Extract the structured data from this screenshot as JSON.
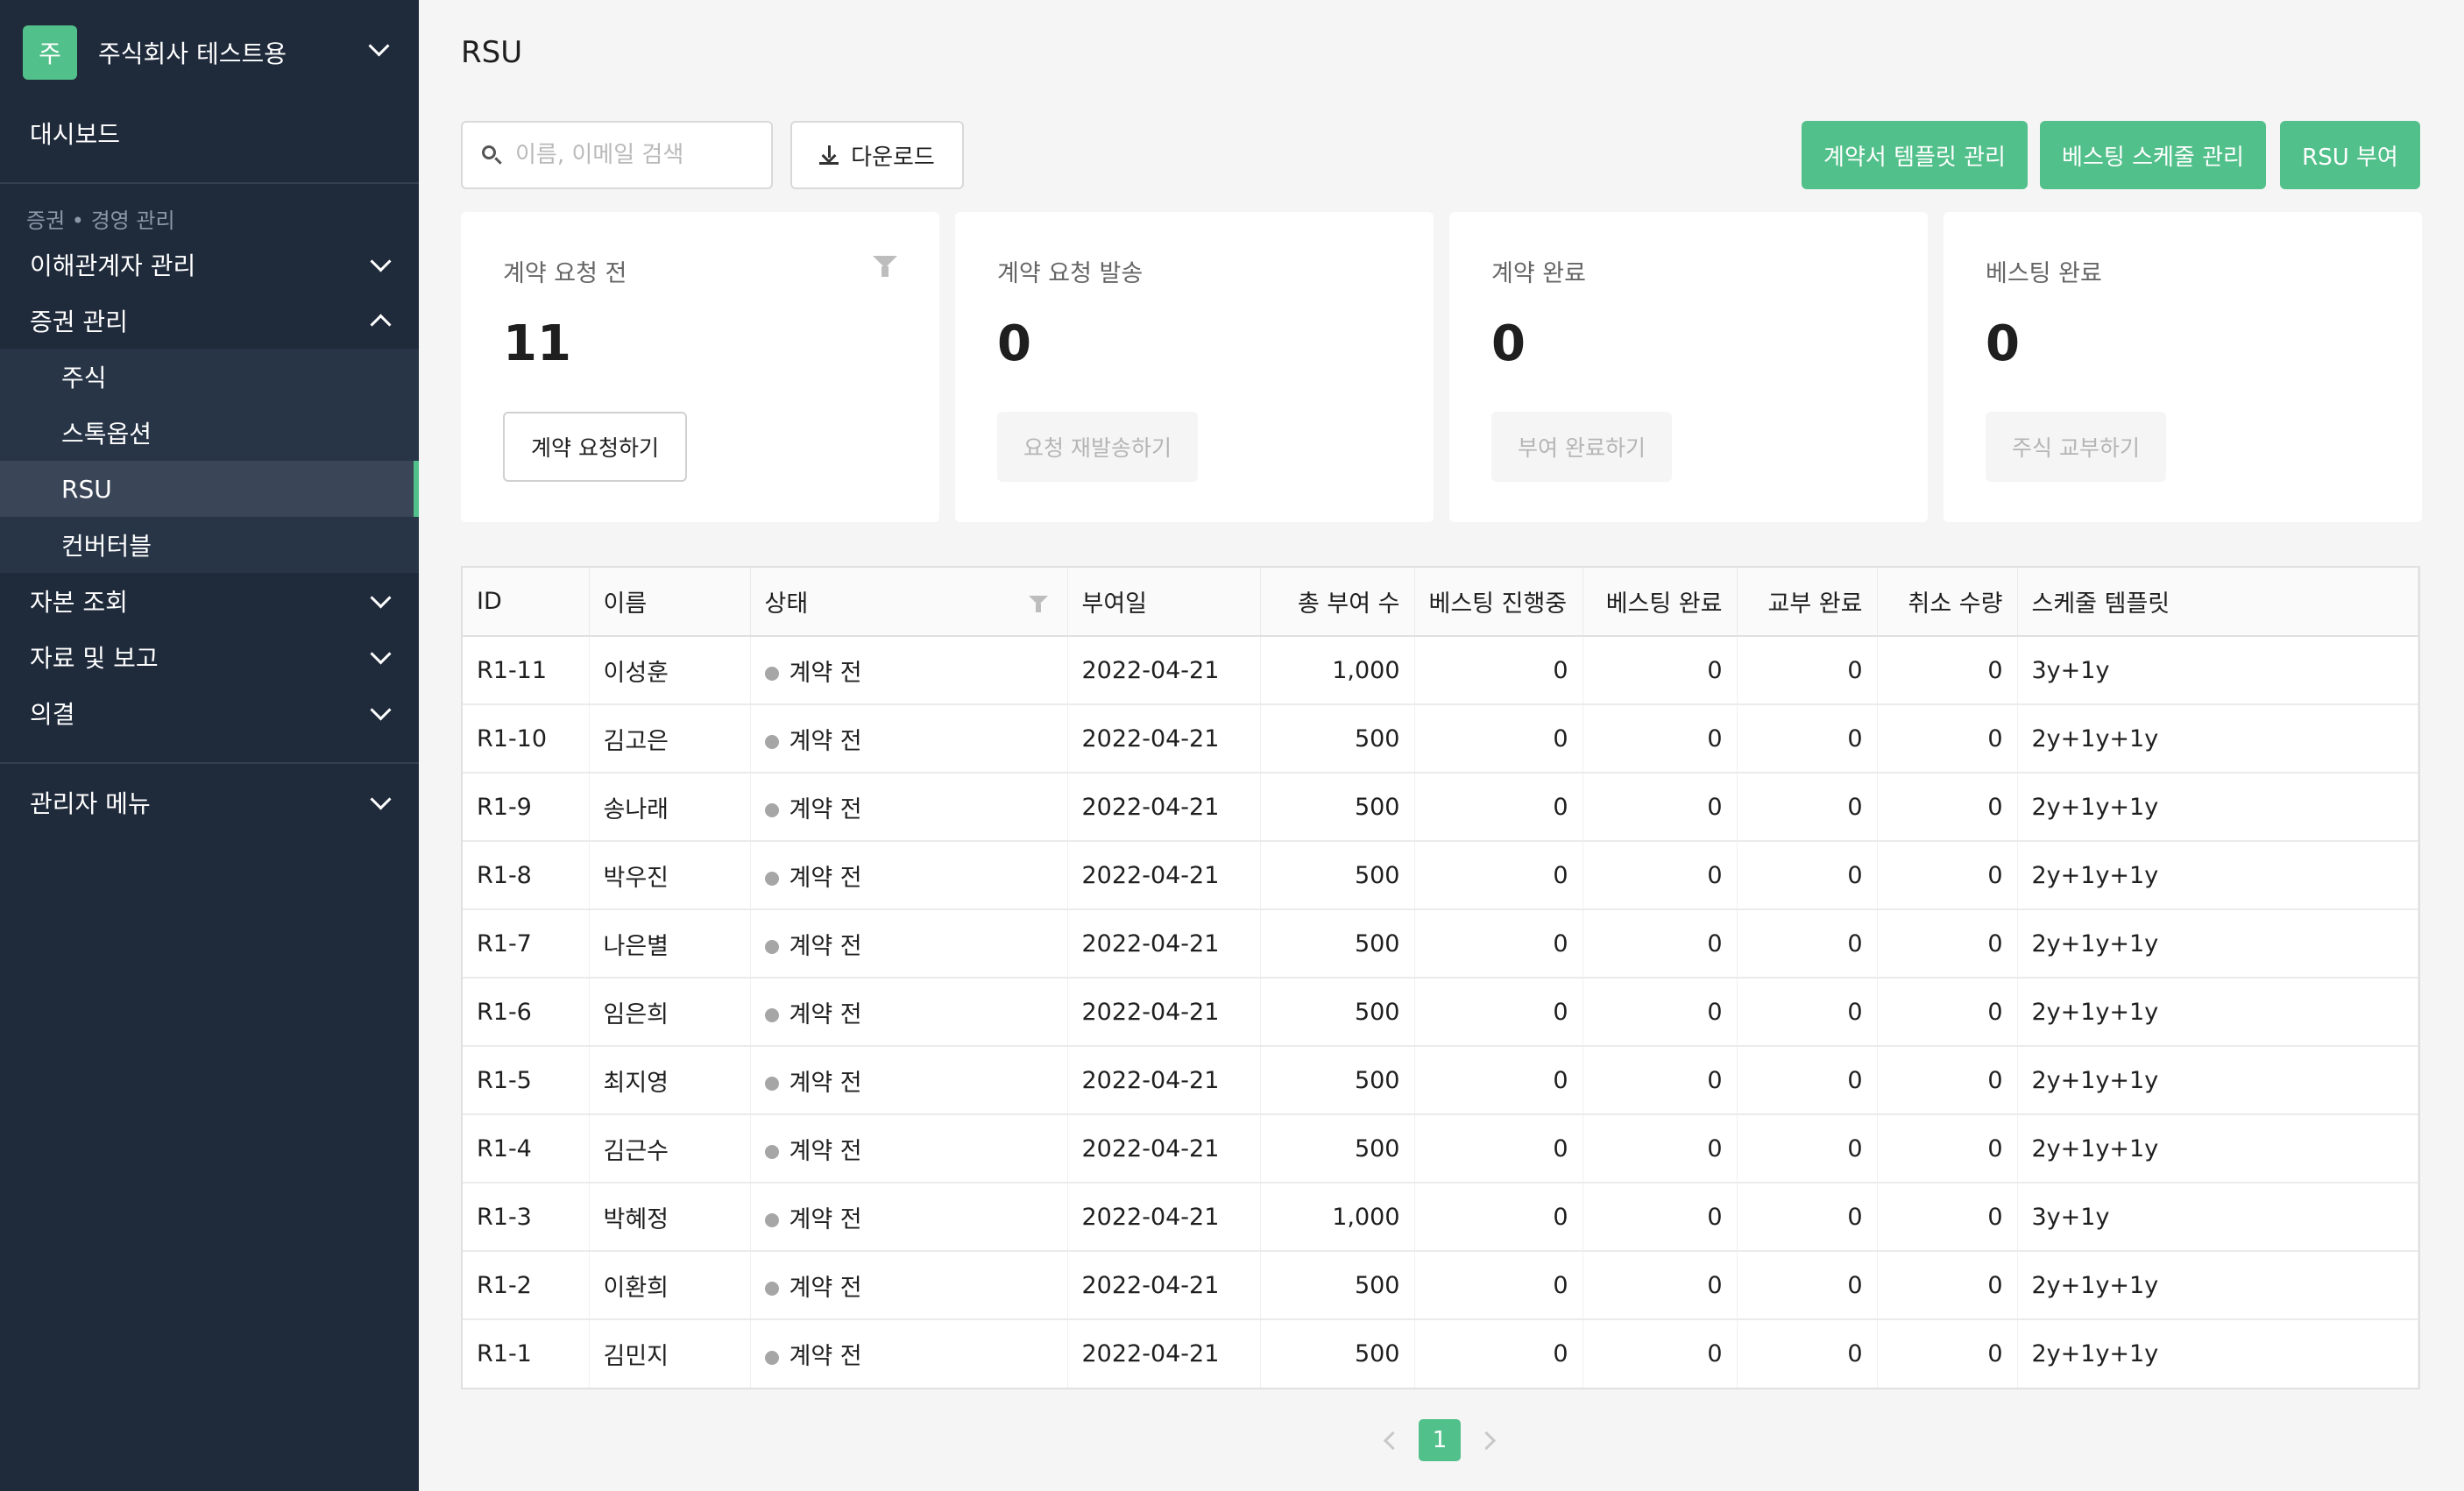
{
  "sidebar": {
    "company_initial": "주",
    "company_name": "주식회사 테스트용",
    "dashboard": "대시보드",
    "section_label": "증권 • 경영 관리",
    "items": [
      {
        "label": "이해관계자 관리"
      },
      {
        "label": "증권 관리"
      },
      {
        "label": "주식"
      },
      {
        "label": "스톡옵션"
      },
      {
        "label": "RSU"
      },
      {
        "label": "컨버터블"
      },
      {
        "label": "자본 조회"
      },
      {
        "label": "자료 및 보고"
      },
      {
        "label": "의결"
      }
    ],
    "admin": "관리자 메뉴"
  },
  "header": {
    "title": "RSU",
    "search_placeholder": "이름, 이메일 검색",
    "download_label": "다운로드",
    "template_label": "계약서 템플릿 관리",
    "schedule_label": "베스팅 스케줄 관리",
    "grant_label": "RSU 부여"
  },
  "cards": [
    {
      "title": "계약 요청 전",
      "value": "11",
      "button": "계약 요청하기"
    },
    {
      "title": "계약 요청 발송",
      "value": "0",
      "button": "요청 재발송하기"
    },
    {
      "title": "계약 완료",
      "value": "0",
      "button": "부여 완료하기"
    },
    {
      "title": "베스팅 완료",
      "value": "0",
      "button": "주식 교부하기"
    }
  ],
  "table": {
    "columns": [
      "ID",
      "이름",
      "상태",
      "부여일",
      "총 부여 수",
      "베스팅 진행중",
      "베스팅 완료",
      "교부 완료",
      "취소 수량",
      "스케줄 템플릿"
    ],
    "rows": [
      [
        "R1-11",
        "이성훈",
        "계약 전",
        "2022-04-21",
        "1,000",
        "0",
        "0",
        "0",
        "0",
        "3y+1y"
      ],
      [
        "R1-10",
        "김고은",
        "계약 전",
        "2022-04-21",
        "500",
        "0",
        "0",
        "0",
        "0",
        "2y+1y+1y"
      ],
      [
        "R1-9",
        "송나래",
        "계약 전",
        "2022-04-21",
        "500",
        "0",
        "0",
        "0",
        "0",
        "2y+1y+1y"
      ],
      [
        "R1-8",
        "박우진",
        "계약 전",
        "2022-04-21",
        "500",
        "0",
        "0",
        "0",
        "0",
        "2y+1y+1y"
      ],
      [
        "R1-7",
        "나은별",
        "계약 전",
        "2022-04-21",
        "500",
        "0",
        "0",
        "0",
        "0",
        "2y+1y+1y"
      ],
      [
        "R1-6",
        "임은희",
        "계약 전",
        "2022-04-21",
        "500",
        "0",
        "0",
        "0",
        "0",
        "2y+1y+1y"
      ],
      [
        "R1-5",
        "최지영",
        "계약 전",
        "2022-04-21",
        "500",
        "0",
        "0",
        "0",
        "0",
        "2y+1y+1y"
      ],
      [
        "R1-4",
        "김근수",
        "계약 전",
        "2022-04-21",
        "500",
        "0",
        "0",
        "0",
        "0",
        "2y+1y+1y"
      ],
      [
        "R1-3",
        "박혜정",
        "계약 전",
        "2022-04-21",
        "1,000",
        "0",
        "0",
        "0",
        "0",
        "3y+1y"
      ],
      [
        "R1-2",
        "이환희",
        "계약 전",
        "2022-04-21",
        "500",
        "0",
        "0",
        "0",
        "0",
        "2y+1y+1y"
      ],
      [
        "R1-1",
        "김민지",
        "계약 전",
        "2022-04-21",
        "500",
        "0",
        "0",
        "0",
        "0",
        "2y+1y+1y"
      ]
    ]
  },
  "pagination": {
    "current": "1"
  },
  "colors": {
    "accent": "#52c08a",
    "sidebar_bg": "#1f2a3b",
    "status_dot": "#a6a6a6"
  }
}
